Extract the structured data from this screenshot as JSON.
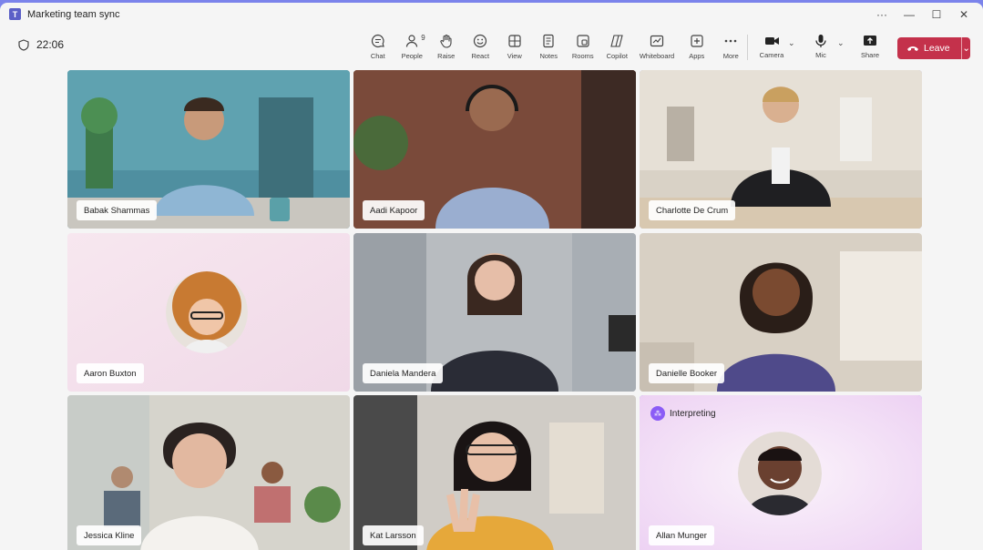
{
  "window": {
    "title": "Marketing team sync"
  },
  "toolbar": {
    "timer": "22:06",
    "tools": [
      {
        "label": "Chat",
        "icon": "chat-icon"
      },
      {
        "label": "People",
        "icon": "people-icon",
        "badge": "9"
      },
      {
        "label": "Raise",
        "icon": "hand-icon"
      },
      {
        "label": "React",
        "icon": "smile-icon"
      },
      {
        "label": "View",
        "icon": "grid-icon"
      },
      {
        "label": "Notes",
        "icon": "notes-icon"
      },
      {
        "label": "Rooms",
        "icon": "rooms-icon"
      },
      {
        "label": "Copilot",
        "icon": "copilot-icon"
      },
      {
        "label": "Whiteboard",
        "icon": "whiteboard-icon"
      },
      {
        "label": "Apps",
        "icon": "apps-icon"
      },
      {
        "label": "More",
        "icon": "more-icon"
      }
    ],
    "camera_label": "Camera",
    "mic_label": "Mic",
    "share_label": "Share",
    "leave_label": "Leave"
  },
  "participants": [
    {
      "name": "Babak Shammas"
    },
    {
      "name": "Aadi Kapoor"
    },
    {
      "name": "Charlotte De Crum"
    },
    {
      "name": "Aaron Buxton"
    },
    {
      "name": "Daniela Mandera"
    },
    {
      "name": "Danielle Booker"
    },
    {
      "name": "Jessica Kline"
    },
    {
      "name": "Kat Larsson"
    },
    {
      "name": "Allan Munger"
    }
  ],
  "interpreting_label": "Interpreting",
  "colors": {
    "accent": "#5b5fc7",
    "leave": "#c4314b",
    "active_border": "#7f85f5"
  }
}
